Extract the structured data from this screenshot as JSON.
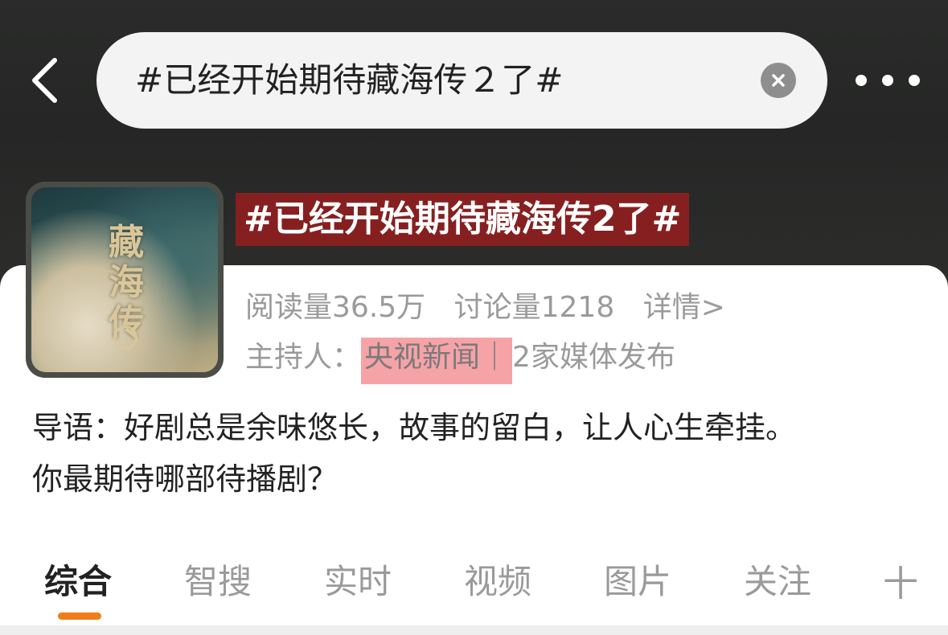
{
  "search": {
    "query": "#已经开始期待藏海传２了#",
    "back_icon": "chevron-left-icon",
    "clear_icon": "close-circle-icon",
    "more_icon": "more-horizontal-icon"
  },
  "topic": {
    "title": "#已经开始期待藏海传2了#",
    "cover_title": "藏海传",
    "reads": "阅读量36.5万",
    "discussions": "讨论量1218",
    "detail_link": "详情>",
    "host_label": "主持人：",
    "host_name": "央视新闻",
    "host_separator": "｜",
    "host_media": "2家媒体发布",
    "intro_line1": "导语：好剧总是余味悠长，故事的留白，让人心生牵挂。",
    "intro_line2": "你最期待哪部待播剧？"
  },
  "tabs": [
    {
      "label": "综合",
      "active": true
    },
    {
      "label": "智搜",
      "active": false
    },
    {
      "label": "实时",
      "active": false
    },
    {
      "label": "视频",
      "active": false
    },
    {
      "label": "图片",
      "active": false
    },
    {
      "label": "关注",
      "active": false
    }
  ],
  "plus_tab": "十",
  "colors": {
    "accent": "#f07d1a",
    "title_bg": "#961e1e",
    "highlight": "#f6a3a8"
  }
}
